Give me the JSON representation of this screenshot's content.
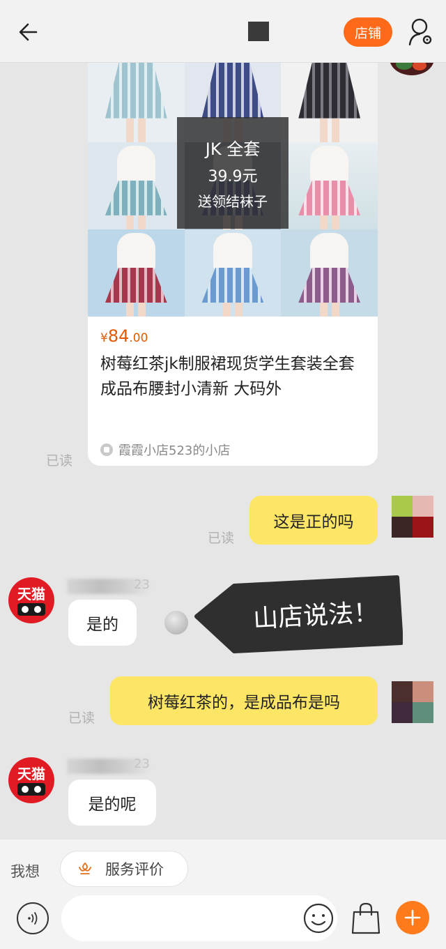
{
  "header": {
    "shop_button_label": "店铺"
  },
  "product": {
    "overlay_line1": "JK 全套",
    "overlay_line2": "39.9元",
    "overlay_line3": "送领结袜子",
    "price_currency": "¥",
    "price_integer": "84",
    "price_decimal": ".00",
    "title": "树莓红茶jk制服裙现货学生套装全套成品布腰封小清新 大码外",
    "shop_name": "霞霞小店523的小店"
  },
  "messages": {
    "read_label": "已读",
    "msg1_text": "这是正的吗",
    "reply1_text": "是的",
    "sender_name_suffix": "23",
    "msg2_text": "树莓红茶的，是成品布是吗",
    "reply2_text": "是的呢",
    "tmall_avatar_text": "天猫"
  },
  "callout": {
    "text": "山店说法！"
  },
  "bottom_bar": {
    "want_label": "我想",
    "service_rating_label": "服务评价",
    "input_placeholder": ""
  },
  "icons": [
    "back-arrow-icon",
    "user-settings-icon",
    "shop-icon",
    "flower-icon",
    "voice-icon",
    "emoji-icon",
    "bag-icon",
    "plus-icon"
  ],
  "colors": {
    "accent_orange": "#ff6a1a",
    "my_bubble": "#fde665",
    "price": "#e25a00",
    "tmall_red": "#e01b23"
  }
}
